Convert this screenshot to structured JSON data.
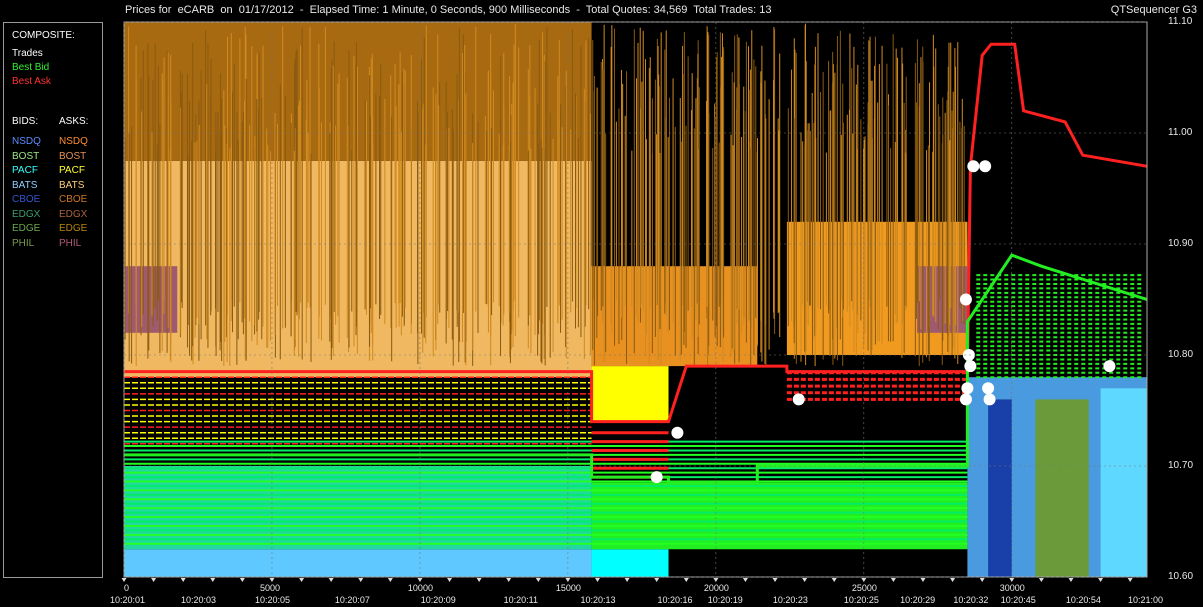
{
  "header": {
    "title": "Prices for  eCARB  on  01/17/2012  -  Elapsed Time: 1 Minute, 0 Seconds, 900 Milliseconds  -  Total Quotes: 34,569  Total Trades: 13",
    "app_name": "QTSequencer G3"
  },
  "legend": {
    "composite_title": "COMPOSITE:",
    "composite": [
      {
        "label": "Trades",
        "color": "#ffffff"
      },
      {
        "label": "Best Bid",
        "color": "#33ee33"
      },
      {
        "label": "Best Ask",
        "color": "#ff3333"
      }
    ],
    "bids_title": "BIDS:",
    "asks_title": "ASKS:",
    "exchanges": [
      {
        "bid": "NSDQ",
        "ask": "NSDQ",
        "bid_color": "#5b8cff",
        "ask_color": "#ff8c33"
      },
      {
        "bid": "BOST",
        "ask": "BOST",
        "bid_color": "#9ee68a",
        "ask_color": "#e0915a"
      },
      {
        "bid": "PACF",
        "ask": "PACF",
        "bid_color": "#33ffff",
        "ask_color": "#ffff33"
      },
      {
        "bid": "BATS",
        "ask": "BATS",
        "bid_color": "#8fd0ff",
        "ask_color": "#ffd07a"
      },
      {
        "bid": "CBOE",
        "ask": "CBOE",
        "bid_color": "#3355cc",
        "ask_color": "#cc7722"
      },
      {
        "bid": "EDGX",
        "ask": "EDGX",
        "bid_color": "#3d9e6e",
        "ask_color": "#a8643a"
      },
      {
        "bid": "EDGE",
        "ask": "EDGE",
        "bid_color": "#6aa84f",
        "ask_color": "#b8860b"
      },
      {
        "bid": "PHIL",
        "ask": "PHIL",
        "bid_color": "#7a9a4a",
        "ask_color": "#b05a7a"
      }
    ]
  },
  "chart_data": {
    "type": "line",
    "title": "",
    "ylim": [
      10.6,
      11.1
    ],
    "xlim": [
      0,
      34569
    ],
    "y_ticks": [
      "11.10",
      "11.00",
      "10.90",
      "10.80",
      "10.70",
      "10.60"
    ],
    "y_tick_values": [
      11.1,
      11.0,
      10.9,
      10.8,
      10.7,
      10.6
    ],
    "x_ticks": [
      "0",
      "5000",
      "10000",
      "15000",
      "20000",
      "25000",
      "30000"
    ],
    "x_tick_values": [
      0,
      5000,
      10000,
      15000,
      20000,
      25000,
      30000
    ],
    "time_labels": [
      "10:20:01",
      "10:20:03",
      "10:20:05",
      "10:20:07",
      "10:20:09",
      "10:20:11",
      "10:20:13",
      "10:20:16",
      "10:20:19",
      "10:20:23",
      "10:20:25",
      "10:20:29",
      "10:20:32",
      "10:20:45",
      "10:20:54",
      "10:21:00"
    ],
    "time_label_positions": [
      0,
      2400,
      4900,
      7600,
      10500,
      13300,
      15900,
      18500,
      20200,
      22400,
      24800,
      26700,
      28500,
      30100,
      32300,
      34400
    ],
    "grid": true,
    "series": [
      {
        "name": "Best Ask",
        "color": "#ff2020",
        "x": [
          0,
          15800,
          15800,
          18400,
          19000,
          22400,
          22400,
          28500,
          28600,
          29000,
          29300,
          30100,
          30400,
          31800,
          32400,
          34569
        ],
        "y": [
          10.785,
          10.785,
          10.74,
          10.74,
          10.79,
          10.79,
          10.785,
          10.785,
          10.97,
          11.07,
          11.08,
          11.08,
          11.02,
          11.01,
          10.98,
          10.97
        ]
      },
      {
        "name": "Best Bid",
        "color": "#22ee22",
        "x": [
          0,
          15800,
          15800,
          18400,
          18400,
          21400,
          21400,
          28500,
          28500,
          30000,
          31000,
          34569
        ],
        "y": [
          10.71,
          10.71,
          10.69,
          10.69,
          10.685,
          10.685,
          10.7,
          10.7,
          10.83,
          10.89,
          10.88,
          10.85
        ]
      },
      {
        "name": "Trades",
        "color": "#ffffff",
        "x": [
          18000,
          18700,
          22800,
          28450,
          28550,
          28600,
          28700,
          29100,
          29200,
          28450,
          29250,
          33300,
          28500
        ],
        "y": [
          10.69,
          10.73,
          10.76,
          10.85,
          10.8,
          10.79,
          10.97,
          10.97,
          10.77,
          10.76,
          10.76,
          10.79,
          10.77
        ]
      }
    ]
  }
}
